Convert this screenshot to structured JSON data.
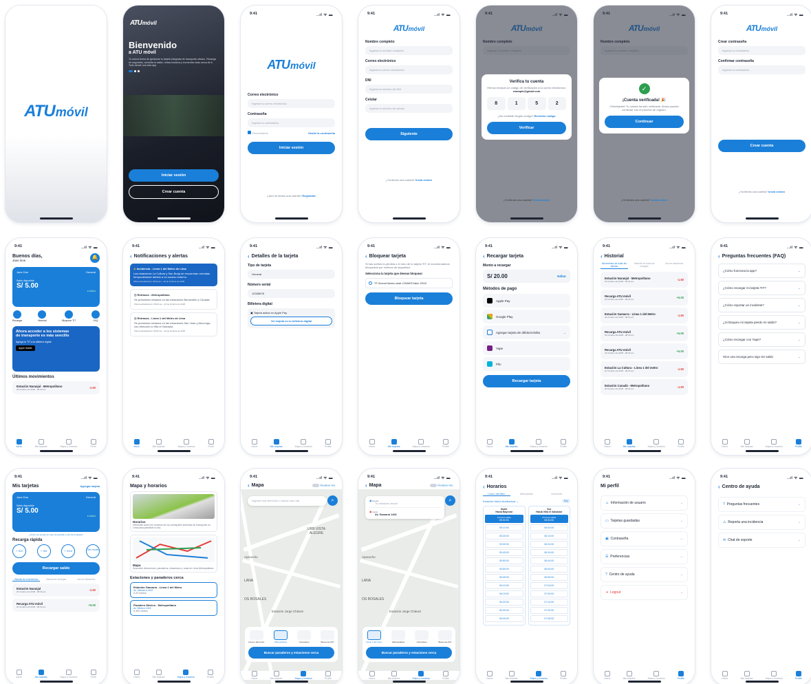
{
  "status": {
    "time": "9:41",
    "indicators": "..ıl ᯤ ▬"
  },
  "brand": {
    "atu": "ATU",
    "movil": "móvil"
  },
  "welcome": {
    "title": "Bienvenido",
    "subtitle": "a ATU móvil",
    "body": "Tu nueva forma de gestionar tu tarjeta integrada de transporte urbano. Recarga en segundos, consulta tu saldo, revisa horarios y encuentra rutas cerca de ti. Todo desde una sola app.",
    "login": "Iniciar sesión",
    "register": "Crear cuenta"
  },
  "login": {
    "email_label": "Correo electrónico",
    "email_ph": "Ingresa tu correo electrónico",
    "pass_label": "Contraseña",
    "pass_ph": "Ingresa tu contraseña",
    "remember": "Recuérdame",
    "forgot": "Olvidé la contraseña",
    "submit": "Iniciar sesión",
    "no_account": "¿Aún no tienes una cuenta?",
    "register": "Regístrate"
  },
  "signup": {
    "name_label": "Nombre completo",
    "name_ph": "Ingresa tu nombre completo",
    "email_label": "Correo electrónico",
    "email_ph": "Ingresa tu correo electrónico",
    "dni_label": "DNI",
    "dni_ph": "Ingresa tu número de DNI",
    "phone_label": "Celular",
    "phone_ph": "Ingresa tu número de celular",
    "next": "Siguiente",
    "have_account": "¿Ya tienes una cuenta?",
    "login": "Inicia sesión"
  },
  "verify": {
    "title": "Verifica tu cuenta",
    "body": "Hemos enviado un código de verificación a tu correo electrónico:",
    "email": "example@gmail.com",
    "digits": [
      "8",
      "1",
      "5",
      "2"
    ],
    "resend_q": "¿No recibiste ningún código?",
    "resend": "Reenviar código",
    "submit": "Verificar"
  },
  "verified": {
    "title": "¡Cuenta verificada! 🎉",
    "body": "¡Felicidades! Tu cuenta ha sido verificada. Ahora puedes continuar con el proceso de registro.",
    "submit": "Continuar"
  },
  "password": {
    "create_label": "Crear contraseña",
    "create_ph": "Ingresa tu contraseña",
    "confirm_label": "Confirmar contraseña",
    "confirm_ph": "Ingresa tu contraseña",
    "submit": "Crear cuenta",
    "have_account": "¿Ya tienes una cuenta?",
    "login": "Inicia sesión"
  },
  "home": {
    "greeting": "Buenos días,",
    "name": "Jane Doe",
    "card_owner": "Jane Doe",
    "card_type": "General",
    "balance_label": "Saldo disponible",
    "balance": "S/ 5.00",
    "card_status": "● Activa",
    "actions": [
      "Recargar",
      "Historial",
      "Bloquear TIT",
      "FAQ"
    ],
    "banner_title": "Ahora acceder a los sistemas de transporte es más sencillo",
    "banner_sub": "Agrega tu TIT a tu billetera digital",
    "banner_btn": "Apple Wallet",
    "recent_title": "Últimos movimientos",
    "recent": [
      {
        "title": "Estación Naranjal - Metropolitano",
        "date": "20 Octubre del 2025 - 08:30 am",
        "amount": "-1.50"
      },
      {
        "title": "Recarga ATU móvil",
        "date": "",
        "amount": ""
      }
    ]
  },
  "notifications": {
    "title": "Notificaciones y alertas",
    "items": [
      {
        "title": "Incidencia - Línea 1 del Metro de Lima",
        "body": "Las estaciones La Cultura y San Borja se encuentran cerradas temporalmente debido a un suceso externo.",
        "time": "Última actualización: 08:20 am - 20 de Octubre de 2025",
        "alert": true
      },
      {
        "title": "Retrasos - Metropolitano",
        "body": "Se presentan retrasos en las estaciones Benavides y Canadá.",
        "time": "Última actualización: 08:20 am - 20 de Octubre de 2025",
        "alert": false
      },
      {
        "title": "Retrasos - Línea 1 del Metro de Lima",
        "body": "Se presentan retrasos en las estaciones San Juan y Atocongo, con dirección a Villa el Salvador.",
        "time": "Última actualización: 08:20 am - 20 de Octubre de 2025",
        "alert": false
      }
    ]
  },
  "card_detail": {
    "title": "Detalles de la tarjeta",
    "type_label": "Tipo de tarjeta",
    "type": "General",
    "serial_label": "Número serial",
    "serial": "12345678",
    "wallet_label": "Billetera digital",
    "wallet": "Tarjeta activa en Apple Pay",
    "wallet_btn": "Ver tarjeta en tu billetera digital"
  },
  "block": {
    "title": "Bloquear tarjeta",
    "body": "Si has sufrido la pérdida o el robo de tu tarjeta TIT, te recomendamos bloquearla por motivos de seguridad.",
    "select": "Selecciona la tarjeta que deseas bloquear",
    "card_row": "TIT General   Número serial: 12345678   Saldo: S/5.00",
    "submit": "Bloquear tarjeta"
  },
  "topup": {
    "title": "Recargar tarjeta",
    "amount_label": "Monto a recargar",
    "amount": "S/ 20.00",
    "edit": "Editar",
    "methods_label": "Métodos de pago",
    "methods": [
      "Apple Pay",
      "Google Play",
      "Agregar tarjeta de débito/crédito",
      "Yape",
      "Plin"
    ],
    "submit": "Recargar tarjeta"
  },
  "history": {
    "title": "Historial",
    "tabs": [
      "Movimientos de todas las tarjetas",
      "Historial de todas las recargas",
      "Uso en estaciones"
    ],
    "items": [
      {
        "title": "Estación Naranjal - Metropolitano",
        "date": "20 Octubre del 2025 - 08:30 am",
        "amount": "-1.50",
        "pos": false
      },
      {
        "title": "Recarga ATU móvil",
        "date": "20 Octubre del 2025 - 08:30 am",
        "amount": "+5.00",
        "pos": true
      },
      {
        "title": "Estación Gamarra - Línea 1 del Metro",
        "date": "20 Octubre del 2025 - 08:30 am",
        "amount": "-1.50",
        "pos": false
      },
      {
        "title": "Recarga ATU móvil",
        "date": "20 Octubre del 2025 - 08:30 am",
        "amount": "+5.00",
        "pos": true
      },
      {
        "title": "Recarga ATU móvil",
        "date": "20 Octubre del 2025 - 08:30 am",
        "amount": "+5.00",
        "pos": true
      },
      {
        "title": "Estación La Cultura - Línea 1 del metro",
        "date": "20 Octubre del 2025 - 08:30 am",
        "amount": "-1.50",
        "pos": false
      },
      {
        "title": "Estación Canadá - Metropolitano",
        "date": "20 Octubre del 2025 - 08:30 am",
        "amount": "-1.50",
        "pos": false
      }
    ]
  },
  "faq": {
    "title": "Preguntas frecuentes (FAQ)",
    "items": [
      "¿Cómo funciona la app?",
      "¿Cómo recargar mi tarjeta TIT?",
      "¿Cómo reportar un incidente?",
      "¿Si bloqueo mi tarjeta pierdo mi saldo?",
      "¿Cómo recargar con Yape?",
      "Hice una recarga pero sigo sin saldo"
    ]
  },
  "cards": {
    "title": "Mis tarjetas",
    "add": "Agregar tarjeta",
    "card_owner": "Jane Doe",
    "card_type": "General",
    "balance_label": "Saldo disponible",
    "balance": "S/ 5.00",
    "status": "● Activa",
    "lost": "¿Cómo me protejo en caso de pérdida o robo de la tarjeta?",
    "quick_title": "Recarga rápida",
    "quick": [
      "+ S/3",
      "+ S/5",
      "+ S/10",
      "Otro monto"
    ],
    "quick_btn": "Recargar saldo",
    "tabs": [
      "Historial de movimientos",
      "Historial de recargas",
      "Uso en estaciones"
    ],
    "items": [
      {
        "title": "Estación Naranjal",
        "date": "20 Octubre del 2025 - 08:30 am",
        "amount": "-1.50",
        "pos": false
      },
      {
        "title": "Recarga ATU móvil",
        "date": "20 Octubre del 2025 - 08:30 am",
        "amount": "+5.00",
        "pos": true
      },
      {
        "title": "Estación Gamarra",
        "date": "",
        "amount": "-1.50",
        "pos": false
      }
    ]
  },
  "maps_menu": {
    "title": "Mapa y horarios",
    "horarios_title": "Horarios",
    "horarios_body": "Infórmate sobre los horarios de los principales sistemas de transporte en Lima para planificar tu día.",
    "mapa_title": "Mapa",
    "mapa_body": "Descubre direcciones, paraderos, estaciones y rutas en Lima Metropolitana.",
    "near_title": "Estaciones y paraderos cerca",
    "near": [
      {
        "title": "Estación Gamarra - Línea 1 del Metro",
        "addr": "Av. Gamarra 1402",
        "dist": "A 20 metros"
      },
      {
        "title": "Paradero México - Metropolitano",
        "addr": "Av. México 1402",
        "dist": "A 300 metros"
      }
    ]
  },
  "map": {
    "title": "Mapa",
    "toggle": "Visualizar ruta",
    "search_ph": "Ingresa una dirección o busca una ruta",
    "labels": [
      "URB VISTA ALEGRE",
      "Ayacucho",
      "LANA",
      "OS ROSALES",
      "Estación Jorge Chávez"
    ],
    "filters": [
      "Línea 1 del metro",
      "Metropolitano",
      "Corredores",
      "Buses de ATU"
    ],
    "submit": "Buscar paraderos y estaciones cerca",
    "from_label": "Desde",
    "from_ph": "Tu ubicación actual",
    "to_label": "Hacia",
    "to": "Av. Gamarra 1402"
  },
  "schedule": {
    "title": "Horarios",
    "tabs": [
      "Línea 1 del Metro",
      "Metropolitano",
      "Corredores"
    ],
    "station": "Estación María Auxiliadora",
    "badge": "Hoy",
    "north_title": "Norte",
    "north_dest": "Hacia Bayóvar",
    "south_title": "Sur",
    "south_dest": "Hacia Villa el Salvador",
    "next_label": "Próxima salida",
    "north_next": "05:02:00",
    "south_next": "05:54:00",
    "north": [
      "05:10:00",
      "05:20:00",
      "05:30:00",
      "05:40:00",
      "05:50:00",
      "05:59:00",
      "06:05:00",
      "06:10:00",
      "06:15:00",
      "06:20:00",
      "06:30:00",
      "06:40:00"
    ],
    "south": [
      "06:04:00",
      "06:14:00",
      "06:24:00",
      "06:34:00",
      "06:44:00",
      "06:54:00",
      "06:59:00",
      "07:04:00",
      "07:09:00",
      "07:14:00",
      "07:20:00",
      "07:28:00"
    ]
  },
  "profile": {
    "title": "Mi perfil",
    "items": [
      "Información de usuario",
      "Tarjetas guardadas",
      "Contraseña",
      "Preferencias",
      "Centro de ayuda",
      "Logout"
    ]
  },
  "help": {
    "title": "Centro de ayuda",
    "items": [
      "Preguntas frecuentes",
      "Reporta una incidencia",
      "Chat de soporte"
    ]
  },
  "tabbar": [
    "Inicio",
    "Mis tarjetas",
    "Mapa y horarios",
    "Perfil"
  ],
  "tabbar_alt": [
    "Home",
    "Mis tarjetas",
    "Mapa y horarios",
    "Profile"
  ],
  "colors": {
    "primary": "#1a7fd9",
    "danger": "#e53935",
    "success": "#2e9e4f"
  }
}
